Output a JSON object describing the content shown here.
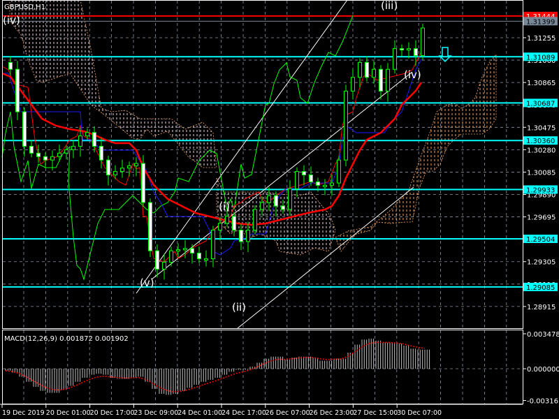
{
  "chart_data": {
    "type": "candlestick",
    "symbol_title": "GBPUSD,H1",
    "price_ticks": [
      "1.31255",
      "1.31060",
      "1.30865",
      "1.30670",
      "1.30475",
      "1.30280",
      "1.30085",
      "1.29890",
      "1.29695",
      "1.29500",
      "1.29305",
      "1.29110",
      "1.28915"
    ],
    "price_tick_values": [
      1.31255,
      1.3106,
      1.30865,
      1.3067,
      1.30475,
      1.3028,
      1.30085,
      1.2989,
      1.29695,
      1.295,
      1.29305,
      1.2911,
      1.28915
    ],
    "levels": [
      {
        "label": "1.31444",
        "value": 1.31444,
        "color": "#ff0000"
      },
      {
        "label": "1.31399",
        "value": 1.31399,
        "color": "#778899"
      },
      {
        "label": "1.31089",
        "value": 1.31089,
        "color": "#00ffff"
      },
      {
        "label": "1.30687",
        "value": 1.30687,
        "color": "#00ffff"
      },
      {
        "label": "1.30360",
        "value": 1.3036,
        "color": "#00ffff"
      },
      {
        "label": "1.29933",
        "value": 1.29933,
        "color": "#00ffff"
      },
      {
        "label": "1.29504",
        "value": 1.29504,
        "color": "#00ffff"
      },
      {
        "label": "1.29085",
        "value": 1.29085,
        "color": "#00ffff"
      }
    ],
    "time_labels": [
      "19 Dec 2019",
      "20 Dec 01:00",
      "20 Dec 17:00",
      "23 Dec 09:00",
      "24 Dec 01:00",
      "24 Dec 17:00",
      "26 Dec 07:00",
      "26 Dec 23:00",
      "27 Dec 15:00",
      "30 Dec 07:00"
    ],
    "closes": [
      1.3104,
      1.3098,
      1.3061,
      1.3031,
      1.3025,
      1.3022,
      1.3019,
      1.3022,
      1.3025,
      1.3028,
      1.3031,
      1.304,
      1.3043,
      1.3031,
      1.3019,
      1.3006,
      1.3009,
      1.3012,
      1.3014,
      1.3016,
      1.2982,
      1.294,
      1.2924,
      1.293,
      1.294,
      1.2941,
      1.2942,
      1.2938,
      1.2933,
      1.2933,
      1.2958,
      1.2964,
      1.297,
      1.2958,
      1.2948,
      1.2958,
      1.2976,
      1.2982,
      1.2988,
      1.2979,
      1.2976,
      1.2994,
      1.3009,
      1.3006,
      1.3,
      1.2997,
      1.2997,
      1.2999,
      1.3019,
      1.3079,
      1.3091,
      1.3104,
      1.3091,
      1.3098,
      1.3079,
      1.3098,
      1.3116,
      1.3115,
      1.3116,
      1.311,
      1.3134
    ],
    "wave_labels": {
      "iv_left": "(iv)",
      "iii": "(iii)",
      "iv_right": "(iv)",
      "i": "(i)",
      "v": "(v)",
      "ii": "(ii)"
    },
    "macd": {
      "label": "MACD(12,26,9) 0.001872 0.001902",
      "ticks": [
        "0.003478",
        "0.000000",
        "-0.003161"
      ],
      "histogram": [
        -0.0002,
        -0.0004,
        -0.0008,
        -0.0013,
        -0.0018,
        -0.0022,
        -0.0024,
        -0.0024,
        -0.0021,
        -0.0017,
        -0.0013,
        -0.0009,
        -0.0006,
        -0.0005,
        -0.0006,
        -0.0009,
        -0.001,
        -0.001,
        -0.0009,
        -0.0008,
        -0.0013,
        -0.002,
        -0.0025,
        -0.0026,
        -0.0025,
        -0.0022,
        -0.0019,
        -0.0016,
        -0.0013,
        -0.0011,
        -0.0009,
        -0.0006,
        -0.0003,
        -0.0001,
        -0.0001,
        0.0002,
        0.0006,
        0.001,
        0.0012,
        0.0012,
        0.0009,
        0.0011,
        0.0012,
        0.0012,
        0.0011,
        0.0008,
        0.0008,
        0.001,
        0.001,
        0.0016,
        0.0024,
        0.0029,
        0.003,
        0.0028,
        0.0026,
        0.0026,
        0.0025,
        0.0023,
        0.002,
        0.0019,
        0.0019
      ]
    },
    "colors": {
      "bull": "#00ff00",
      "bear": "#ffffff",
      "level": "#00ffff",
      "ma": "#ff0000",
      "kijun": "#0000ff",
      "chikou": "#00ff00"
    }
  }
}
